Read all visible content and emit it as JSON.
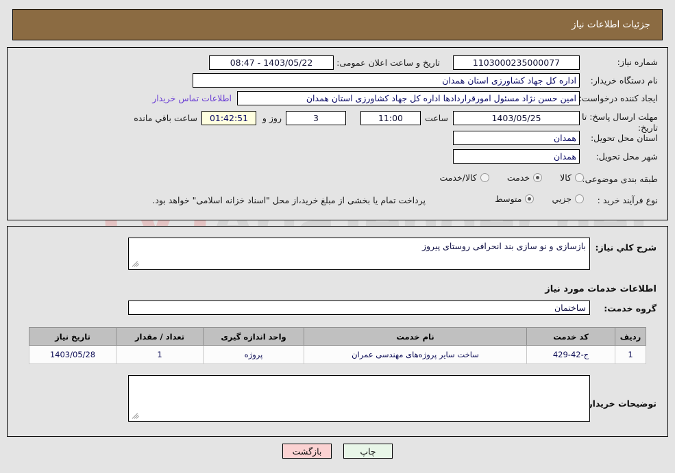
{
  "header": {
    "title": "جزئیات اطلاعات نیاز"
  },
  "watermark": {
    "text": "AriaTender.net",
    "icon": "shield-logo-icon",
    "color": "#cfcfcf"
  },
  "top_panel": {
    "need_number": {
      "label": "شماره نیاز:",
      "value": "1103000235000077"
    },
    "announce_datetime": {
      "label": "تاریخ و ساعت اعلان عمومی:",
      "value": "1403/05/22 - 08:47"
    },
    "buyer_org": {
      "label": "نام دستگاه خریدار:",
      "value": "اداره کل جهاد کشاورزی استان همدان"
    },
    "creator": {
      "label": "ایجاد کننده درخواست:",
      "value": "امین حسن نژاد مسئول امورقراردادها اداره کل جهاد کشاورزی استان همدان",
      "contact_link": "اطلاعات تماس خریدار"
    },
    "deadline": {
      "label": "مهلت ارسال پاسخ: تا تاریخ:",
      "date": "1403/05/25",
      "time_label": "ساعت",
      "time": "11:00",
      "days": "3",
      "days_suffix": "روز و",
      "countdown": "01:42:51",
      "countdown_suffix": "ساعت باقي مانده"
    },
    "delivery_province": {
      "label": "استان محل تحویل:",
      "value": "همدان"
    },
    "delivery_city": {
      "label": "شهر محل تحویل:",
      "value": "همدان"
    },
    "category": {
      "label": "طبقه بندی موضوعی:",
      "options": [
        "کالا",
        "خدمت",
        "کالا/خدمت"
      ],
      "selected": "خدمت"
    },
    "purchase_process": {
      "label": "نوع فرآیند خرید :",
      "options": [
        "جزیي",
        "متوسط"
      ],
      "selected": "متوسط",
      "note": "پرداخت تمام یا بخشی از مبلغ خرید،از محل \"اسناد خزانه اسلامی\" خواهد بود."
    }
  },
  "bottom_panel": {
    "general_description": {
      "label": "شرح کلي نیاز:",
      "value": "بازسازی و نو سازی بند انحرافی روستای پیروز"
    },
    "services_section_title": "اطلاعات خدمات مورد نیاز",
    "service_group": {
      "label": "گروه خدمت:",
      "value": "ساختمان"
    },
    "buyer_notes": {
      "label": "توضیحات خریدار:",
      "value": ""
    }
  },
  "table": {
    "columns": [
      "ردیف",
      "کد خدمت",
      "نام خدمت",
      "واحد اندازه گیری",
      "تعداد / مقدار",
      "تاریخ نیاز"
    ],
    "rows": [
      {
        "row_no": "1",
        "service_code": "ج-42-429",
        "service_name": "ساخت سایر پروژه‌های مهندسی عمران",
        "unit": "پروژه",
        "quantity": "1",
        "need_date": "1403/05/28"
      }
    ]
  },
  "buttons": {
    "print": "چاپ",
    "back": "بازگشت"
  }
}
